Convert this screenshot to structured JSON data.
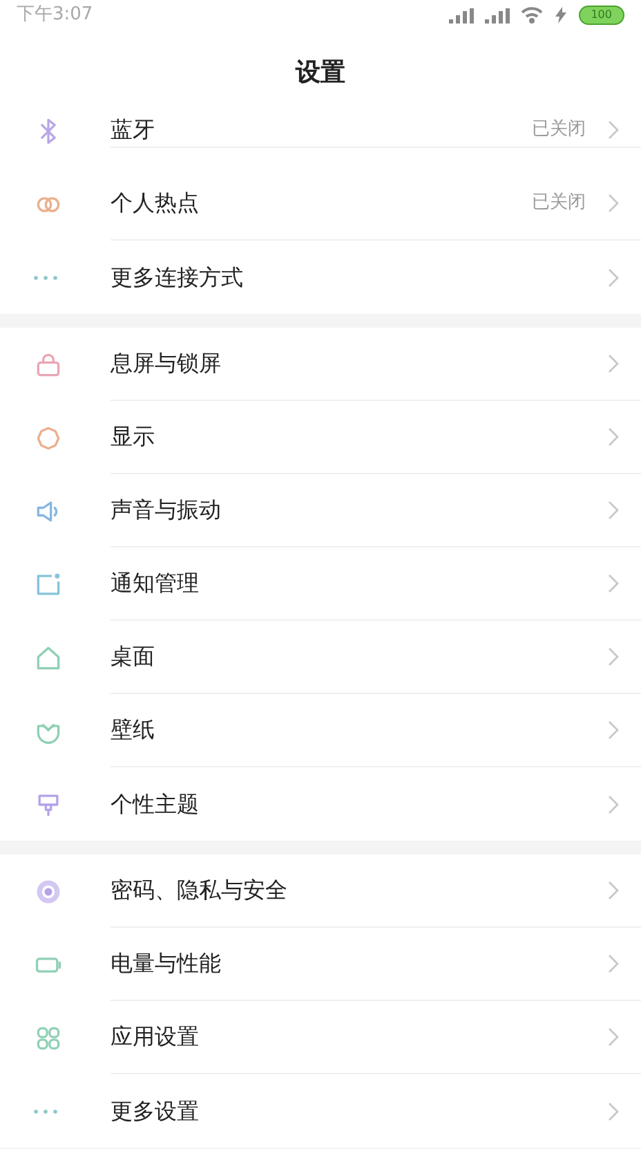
{
  "status_bar": {
    "time": "下午3:07",
    "battery": "100"
  },
  "title": "设置",
  "groups": [
    {
      "items": [
        {
          "kind": "bluetooth",
          "label": "蓝牙",
          "value": "已关闭"
        },
        {
          "kind": "hotspot",
          "label": "个人热点",
          "value": "已关闭"
        },
        {
          "kind": "dots",
          "label": "更多连接方式"
        }
      ]
    },
    {
      "items": [
        {
          "kind": "lock",
          "label": "息屏与锁屏"
        },
        {
          "kind": "sun",
          "label": "显示"
        },
        {
          "kind": "speaker",
          "label": "声音与振动"
        },
        {
          "kind": "notify",
          "label": "通知管理"
        },
        {
          "kind": "home",
          "label": "桌面"
        },
        {
          "kind": "flower",
          "label": "壁纸"
        },
        {
          "kind": "brush",
          "label": "个性主题"
        }
      ]
    },
    {
      "items": [
        {
          "kind": "shield",
          "label": "密码、隐私与安全"
        },
        {
          "kind": "battery",
          "label": "电量与性能"
        },
        {
          "kind": "apps",
          "label": "应用设置"
        },
        {
          "kind": "dots",
          "label": "更多设置"
        }
      ]
    }
  ]
}
